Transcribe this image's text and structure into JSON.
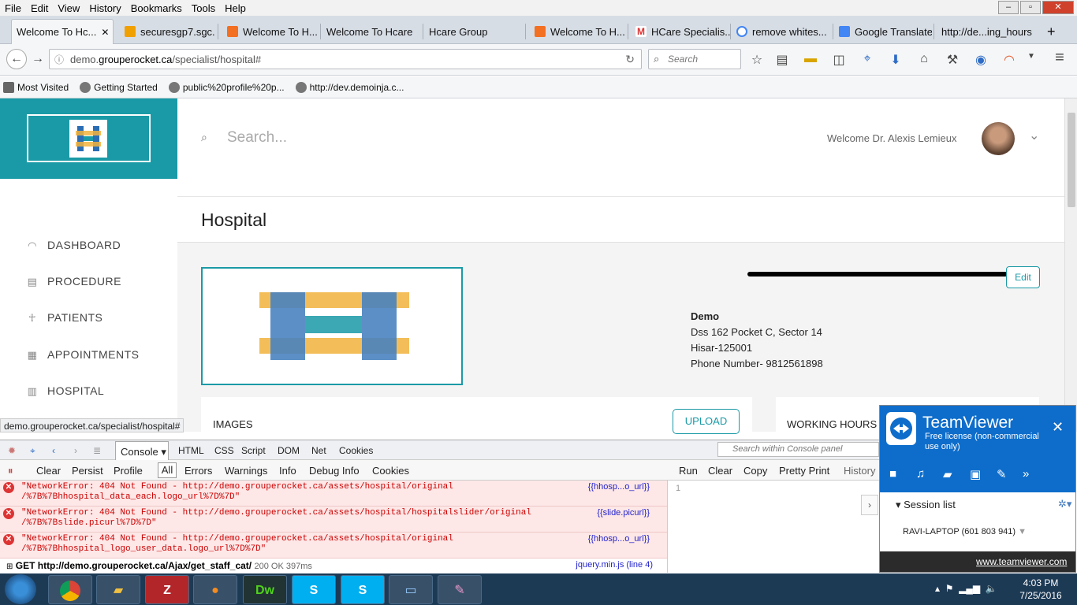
{
  "menubar": {
    "items": [
      "File",
      "Edit",
      "View",
      "History",
      "Bookmarks",
      "Tools",
      "Help"
    ]
  },
  "tabs": [
    {
      "label": "Welcome To Hc...",
      "active": true,
      "favicon": "globe-icon"
    },
    {
      "label": "securesgp7.sgc...",
      "favicon": "pma-icon"
    },
    {
      "label": "Welcome To H...",
      "favicon": "xampp-icon"
    },
    {
      "label": "Welcome To Hcare",
      "favicon": "none"
    },
    {
      "label": "Hcare Group",
      "favicon": "none"
    },
    {
      "label": "Welcome To H...",
      "favicon": "xampp-icon"
    },
    {
      "label": "HCare Specialis...",
      "favicon": "gmail-icon"
    },
    {
      "label": "remove whites...",
      "favicon": "google-icon"
    },
    {
      "label": "Google Translate",
      "favicon": "translate-icon"
    },
    {
      "label": "http://de...ing_hours",
      "favicon": "none"
    }
  ],
  "nav": {
    "url_host_prefix": "demo.",
    "url_host": "grouperocket.ca",
    "url_path": "/specialist/hospital#",
    "search_placeholder": "Search"
  },
  "bookmarks": [
    "Most Visited",
    "Getting Started",
    "public%20profile%20p...",
    "http://dev.demoinja.c..."
  ],
  "app": {
    "search_placeholder": "Search...",
    "welcome": "Welcome Dr. Alexis Lemieux",
    "sidebar": [
      {
        "label": "DASHBOARD",
        "icon": "wifi-icon"
      },
      {
        "label": "PROCEDURE",
        "icon": "document-icon"
      },
      {
        "label": "PATIENTS",
        "icon": "person-icon"
      },
      {
        "label": "APPOINTMENTS",
        "icon": "calendar-icon"
      },
      {
        "label": "HOSPITAL",
        "icon": "building-icon"
      }
    ],
    "page_title": "Hospital",
    "edit_label": "Edit",
    "hospital": {
      "name": "Demo",
      "address1": "Dss 162 Pocket C, Sector 14",
      "address2": "Hisar-125001",
      "phone": "Phone Number- 9812561898"
    },
    "images_label": "IMAGES",
    "upload_label": "UPLOAD",
    "working_hours_label": "WORKING HOURS",
    "brand_color": "#1a9aa6"
  },
  "status_url": "demo.grouperocket.ca/specialist/hospital#",
  "firebug": {
    "tabs": [
      "Console",
      "HTML",
      "CSS",
      "Script",
      "DOM",
      "Net",
      "Cookies"
    ],
    "search_placeholder": "Search within Console panel",
    "filters": [
      "Clear",
      "Persist",
      "Profile",
      "All",
      "Errors",
      "Warnings",
      "Info",
      "Debug Info",
      "Cookies"
    ],
    "actions": [
      "Run",
      "Clear",
      "Copy",
      "Pretty Print",
      "History"
    ],
    "errors": [
      {
        "line1": "\"NetworkError: 404 Not Found - http://demo.grouperocket.ca/assets/hospital/original",
        "line2": "/%7B%7Bhhospital_data_each.logo_url%7D%7D\"",
        "src": "{{hhosp...o_url}}"
      },
      {
        "line1": "\"NetworkError: 404 Not Found - http://demo.grouperocket.ca/assets/hospital/hospitalslider/original",
        "line2": "/%7B%7Bslide.picurl%7D%7D\"",
        "src": "{{slide.picurl}}"
      },
      {
        "line1": "\"NetworkError: 404 Not Found - http://demo.grouperocket.ca/assets/hospital/original",
        "line2": "/%7B%7Bhhospital_logo_user_data.logo_url%7D%7D\"",
        "src": "{{hhosp...o_url}}"
      }
    ],
    "get_request": {
      "label": "GET http://demo.grouperocket.ca/Ajax/get_staff_cat/",
      "status": "200 OK 397ms",
      "src": "jquery.min.js (line 4)"
    },
    "line_number": "1"
  },
  "teamviewer": {
    "title": "TeamViewer",
    "license": "Free license (non-commercial use only)",
    "session_list": "Session list",
    "session_item": "RAVI-LAPTOP (601 803 941)",
    "link": "www.teamviewer.com",
    "color": "#0e6dcb"
  },
  "taskbar": {
    "time": "4:03 PM",
    "date": "7/25/2016",
    "apps": [
      "chrome",
      "explorer",
      "filezilla",
      "firefox",
      "dreamweaver",
      "skype",
      "skype",
      "image-viewer",
      "paint"
    ]
  }
}
